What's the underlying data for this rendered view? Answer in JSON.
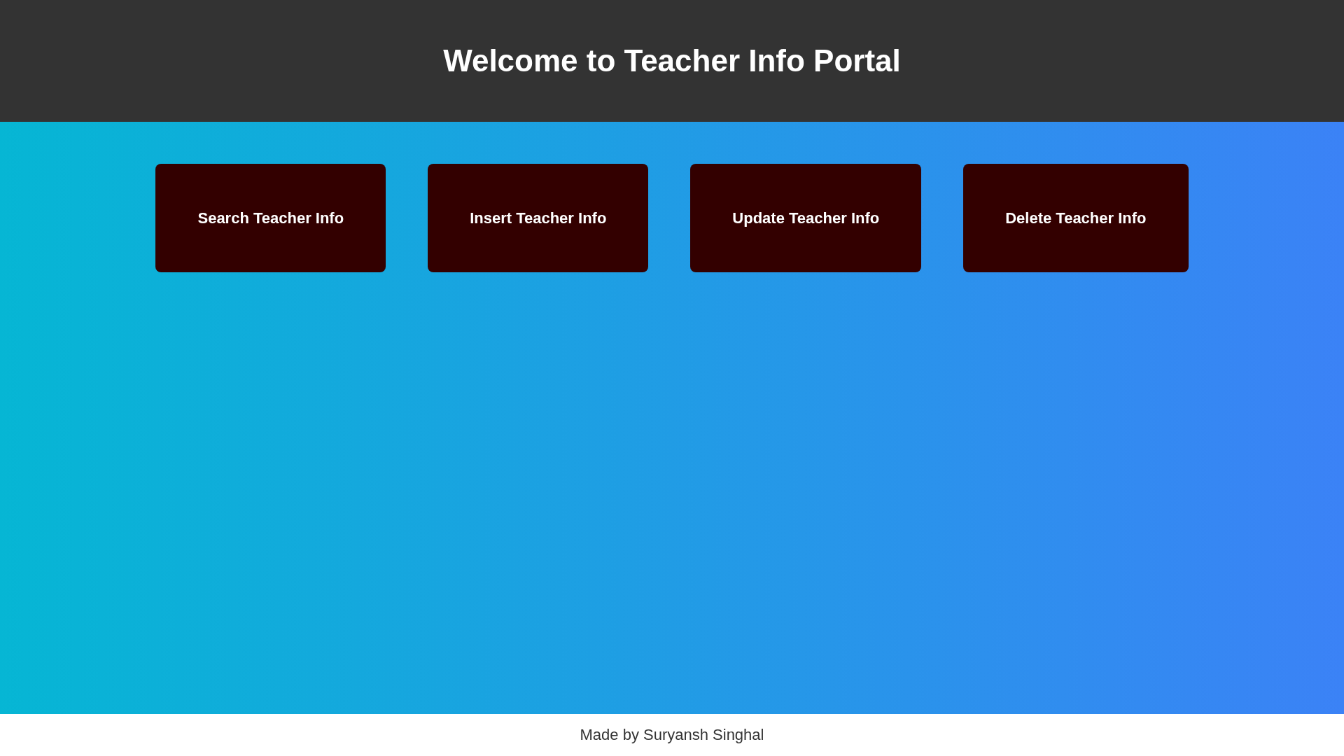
{
  "header": {
    "title": "Welcome to Teacher Info Portal"
  },
  "actions": [
    {
      "label": "Search Teacher Info"
    },
    {
      "label": "Insert Teacher Info"
    },
    {
      "label": "Update Teacher Info"
    },
    {
      "label": "Delete Teacher Info"
    }
  ],
  "footer": {
    "text": "Made by Suryansh Singhal"
  }
}
